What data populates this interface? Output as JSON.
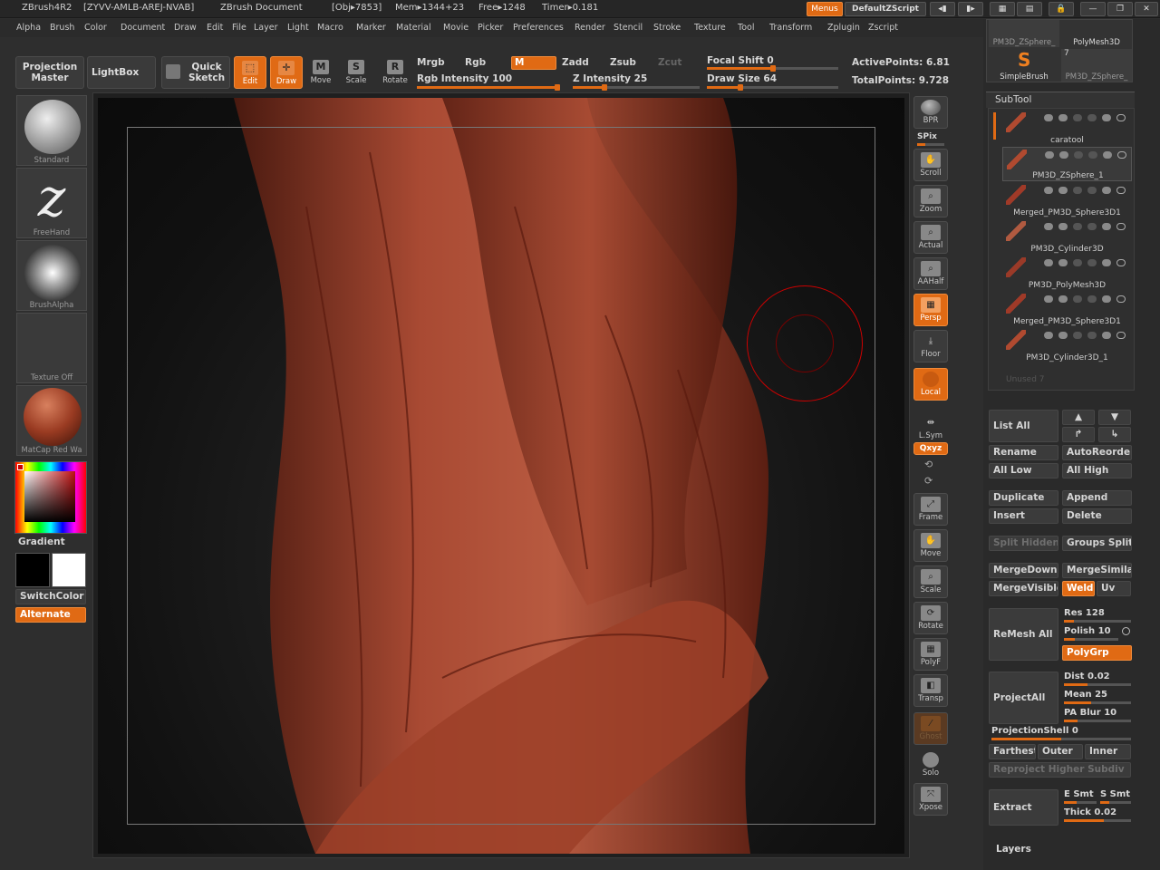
{
  "titlebar": {
    "app": "ZBrush4R2",
    "serial": "[ZYVV-AMLB-AREJ-NVAB]",
    "doc": "ZBrush Document",
    "obj": "[Obj▸7853]",
    "mem": "Mem▸1344+23",
    "free": "Free▸1248",
    "timer": "Timer▸0.181",
    "menus_btn": "Menus",
    "script_btn": "DefaultZScript"
  },
  "menubar": [
    "Alpha",
    "Brush",
    "Color",
    "Document",
    "Draw",
    "Edit",
    "File",
    "Layer",
    "Light",
    "Macro",
    "Marker",
    "Material",
    "Movie",
    "Picker",
    "Preferences",
    "Render",
    "Stencil",
    "Stroke",
    "Texture",
    "Tool",
    "Transform",
    "Zplugin",
    "Zscript"
  ],
  "toolbar": {
    "projection_master": "Projection Master",
    "lightbox": "LightBox",
    "quick_sketch": "Quick Sketch",
    "edit": "Edit",
    "draw": "Draw",
    "move": "Move",
    "scale": "Scale",
    "rotate": "Rotate",
    "mrgb": "Mrgb",
    "rgb": "Rgb",
    "m": "M",
    "zadd": "Zadd",
    "zsub": "Zsub",
    "zcut": "Zcut",
    "rgb_intensity": "Rgb Intensity 100",
    "z_intensity": "Z Intensity 25",
    "focal_shift": "Focal Shift 0",
    "draw_size": "Draw Size 64",
    "active_points": "ActivePoints: 6.81",
    "total_points": "TotalPoints: 9.728",
    "rgb_intensity_value": 100,
    "z_intensity_value": 25,
    "draw_size_value": 64
  },
  "left": {
    "standard": "Standard",
    "freehand": "FreeHand",
    "brushalpha": "BrushAlpha",
    "texture_off": "Texture Off",
    "matcap": "MatCap Red Wa",
    "gradient": "Gradient",
    "switchcolor": "SwitchColor",
    "alternate": "Alternate"
  },
  "shelf": {
    "bpr": "BPR",
    "spix": "SPix",
    "scroll": "Scroll",
    "zoom": "Zoom",
    "actual": "Actual",
    "aahalf": "AAHalf",
    "persp": "Persp",
    "floor": "Floor",
    "local": "Local",
    "lsym": "L.Sym",
    "xyz": "Qxyz",
    "frame": "Frame",
    "move": "Move",
    "scale": "Scale",
    "rotate": "Rotate",
    "polyf": "PolyF",
    "transp": "Transp",
    "ghost": "Ghost",
    "solo": "Solo",
    "xpose": "Xpose"
  },
  "tray": {
    "top_thumbs": [
      "PM3D_ZSphere_",
      "PolyMesh3D",
      "SimpleBrush",
      "PM3D_ZSphere_"
    ],
    "thumb_count": "7",
    "subtool_title": "SubTool",
    "subtools": [
      "caratool",
      "PM3D_ZSphere_1",
      "Merged_PM3D_Sphere3D1",
      "PM3D_Cylinder3D",
      "PM3D_PolyMesh3D",
      "Merged_PM3D_Sphere3D1",
      "PM3D_Cylinder3D_1"
    ],
    "unused": "Unused 7",
    "list_all": "List All",
    "rename": "Rename",
    "autoreorder": "AutoReorder",
    "all_low": "All Low",
    "all_high": "All High",
    "duplicate": "Duplicate",
    "append": "Append",
    "insert": "Insert",
    "delete": "Delete",
    "split_hidden": "Split Hidden",
    "groups_split": "Groups Split",
    "mergedown": "MergeDown",
    "mergesimilar": "MergeSimilar",
    "mergevisible": "MergeVisible",
    "weld": "Weld",
    "uv": "Uv",
    "remesh_all": "ReMesh All",
    "res": "Res 128",
    "polish": "Polish 10",
    "polygrp": "PolyGrp",
    "projectall": "ProjectAll",
    "dist": "Dist 0.02",
    "mean": "Mean 25",
    "pa_blur": "PA Blur 10",
    "projectionshell": "ProjectionShell 0",
    "farthest": "Farthest",
    "outer": "Outer",
    "inner": "Inner",
    "reproject": "Reproject Higher Subdiv",
    "extract": "Extract",
    "e_smt": "E Smt",
    "s_smt": "S Smt",
    "thick": "Thick 0.02",
    "layers": "Layers"
  }
}
